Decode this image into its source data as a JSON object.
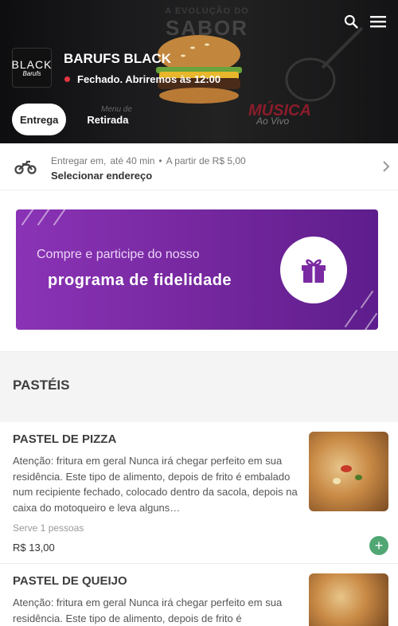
{
  "store": {
    "name": "BARUFS BLACK",
    "status": "Fechado. Abriremos às 12:00",
    "logo_line1": "BLACK",
    "logo_line2": "Barufs"
  },
  "hero_art": {
    "small_text": "A EVOLUÇÃO DO",
    "big_text": "SABOR",
    "musica": "MÚSICA",
    "ao_vivo": "Ao Vivo",
    "menu_de": "Menu de"
  },
  "header_icons": [
    "search-icon",
    "menu-icon"
  ],
  "tabs": [
    {
      "label": "Entrega",
      "active": true
    },
    {
      "label": "Retirada",
      "active": false
    }
  ],
  "delivery": {
    "prefix": "Entregar em,",
    "time": "até 40 min",
    "separator": "•",
    "min_price": "A partir de R$ 5,00",
    "address_cta": "Selecionar endereço"
  },
  "banner": {
    "line1": "Compre e participe do nosso",
    "line2": "programa de fidelidade"
  },
  "section": {
    "title": "PASTÉIS"
  },
  "products": [
    {
      "title": "PASTEL DE PIZZA",
      "description": "Atenção: fritura em geral Nunca irá chegar perfeito em sua residência. Este tipo de alimento, depois de frito é embalado num recipiente fechado, colocado dentro da sacola, depois na caixa do motoqueiro e leva alguns…",
      "serves": "Serve 1 pessoas",
      "price": "R$ 13,00"
    },
    {
      "title": "PASTEL DE QUEIJO",
      "description": "Atenção: fritura em geral Nunca irá chegar perfeito em sua residência. Este tipo de alimento, depois de frito é"
    }
  ],
  "colors": {
    "accent_green": "#50a773",
    "closed_red": "#e7353f",
    "banner_purple": "#7a2aa3"
  }
}
